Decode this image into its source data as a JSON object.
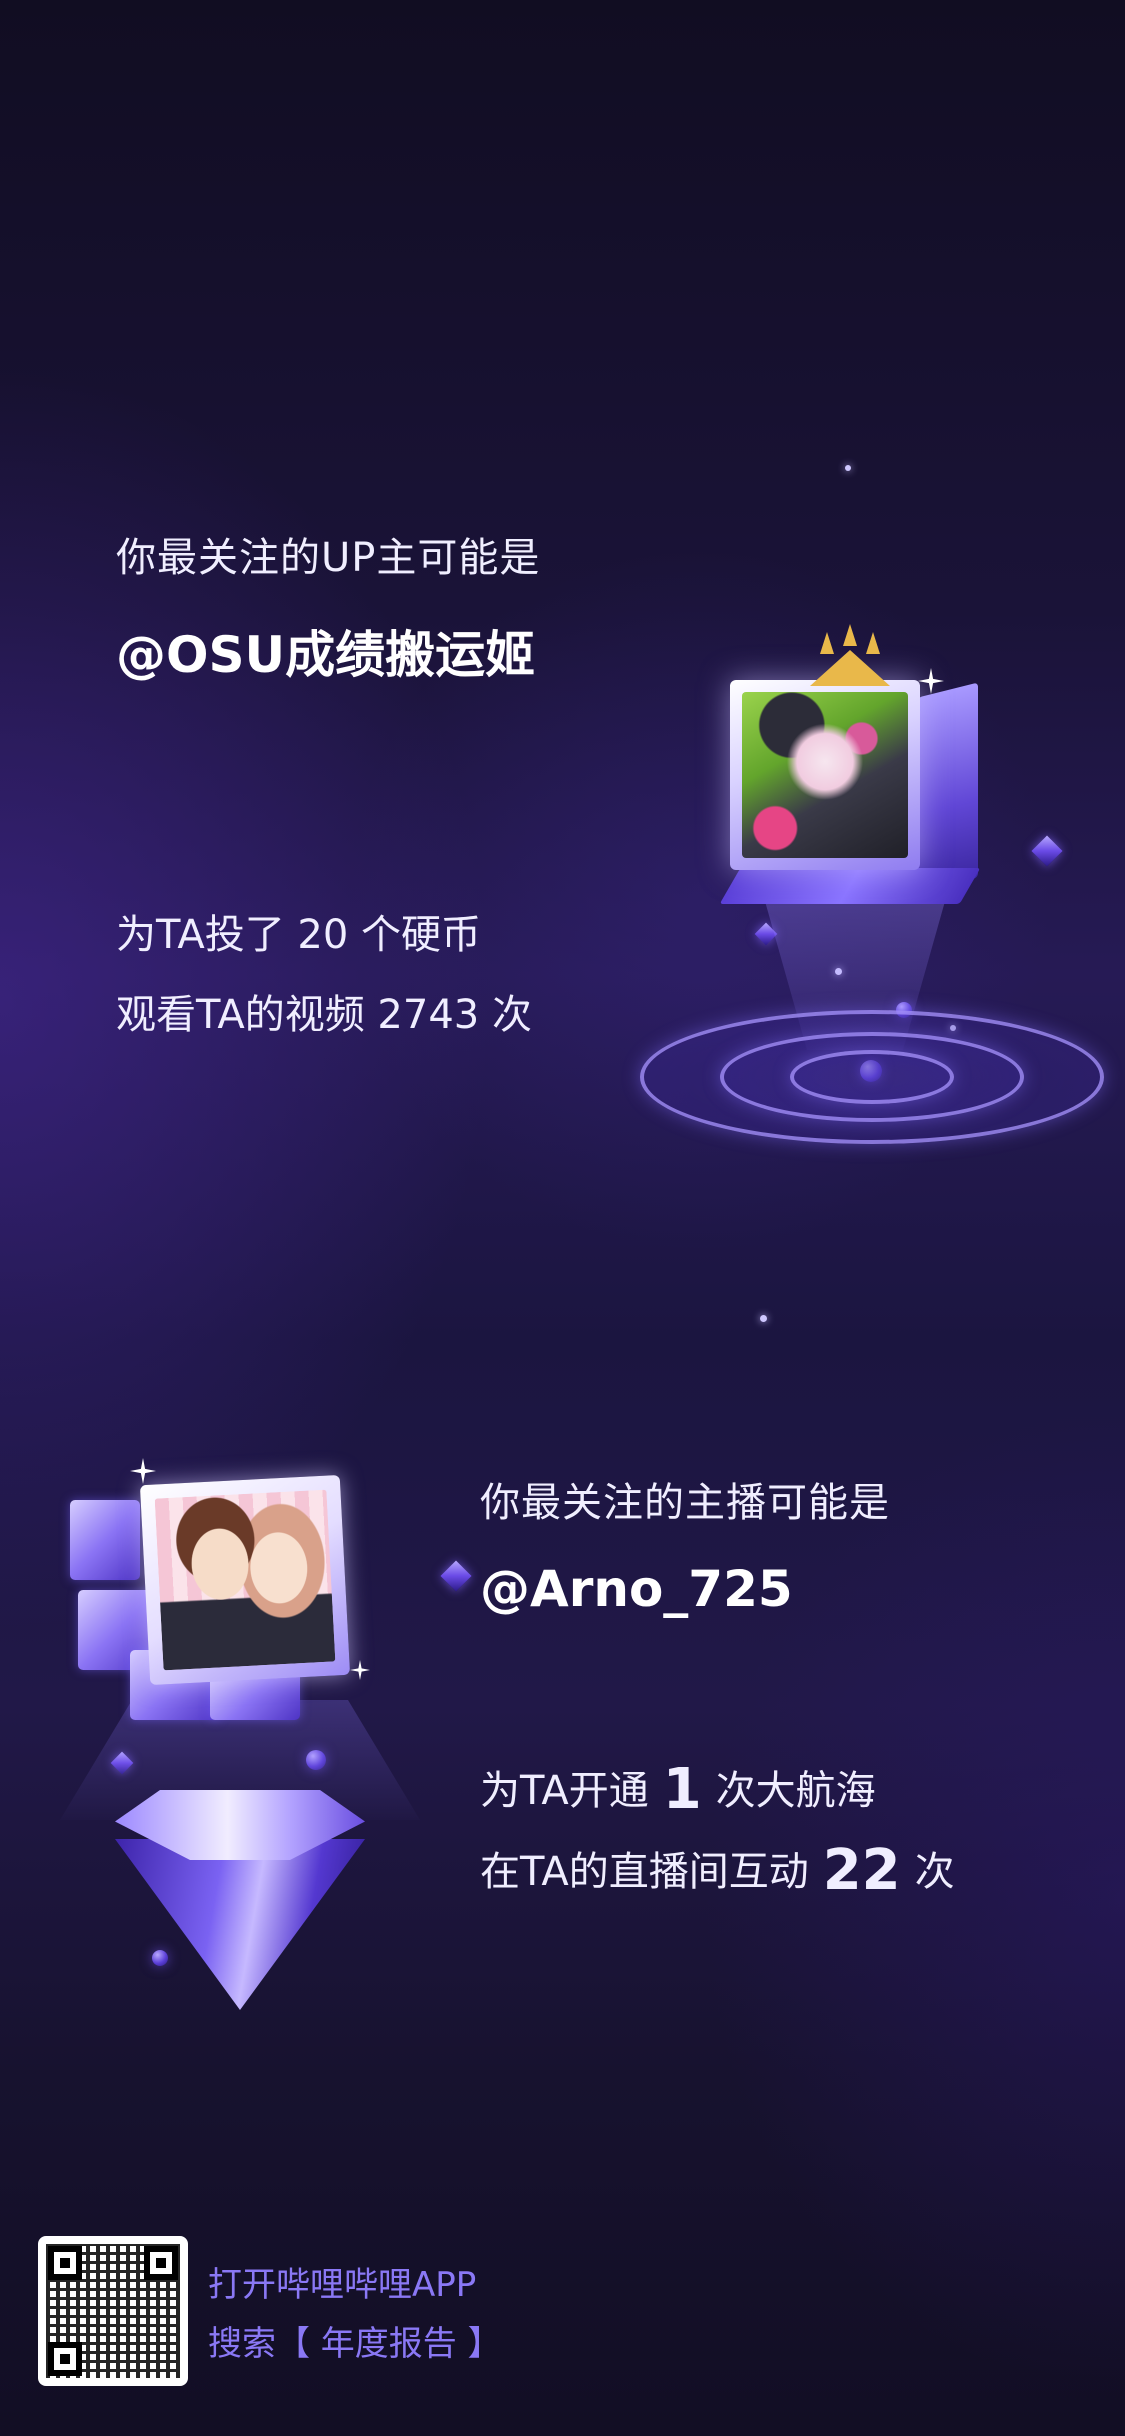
{
  "up_section": {
    "label": "你最关注的UP主可能是",
    "name": "@OSU成绩搬运姬",
    "coins_prefix": "为TA投了",
    "coins_count": "20",
    "coins_suffix": "个硬币",
    "views_prefix": "观看TA的视频",
    "views_count": "2743",
    "views_suffix": "次"
  },
  "streamer_section": {
    "label": "你最关注的主播可能是",
    "name": "@Arno_725",
    "guard_prefix": "为TA开通",
    "guard_count": "1",
    "guard_suffix": "次大航海",
    "interact_prefix": "在TA的直播间互动",
    "interact_count": "22",
    "interact_suffix": "次"
  },
  "footer": {
    "line1": "打开哔哩哔哩APP",
    "line2": "搜索【 年度报告 】"
  },
  "colors": {
    "accent": "#8a78f5",
    "background": "#1b1540",
    "crown": "#e9b84a"
  },
  "icons": {
    "up_avatar": "up-avatar-image",
    "streamer_avatar": "streamer-avatar-image",
    "qr": "qr-code-image"
  }
}
